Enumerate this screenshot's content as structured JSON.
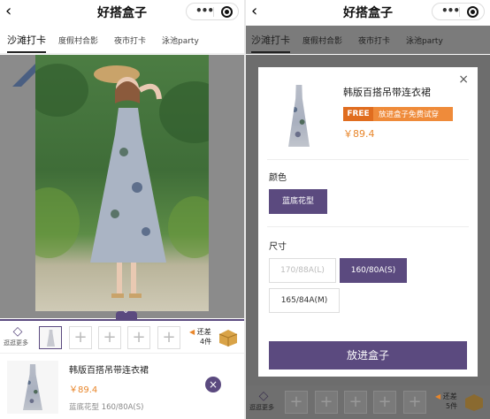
{
  "page": {
    "title": "好搭盒子",
    "back_glyph": "‹",
    "more_glyph": "•••"
  },
  "tabs": [
    "沙滩打卡",
    "度假村合影",
    "夜市打卡",
    "泳池party"
  ],
  "left": {
    "bottom_bar": {
      "more_label": "逛逛更多",
      "add_glyph": "+",
      "remaining_prefix": "还差",
      "remaining_count": "4件"
    },
    "item": {
      "name": "韩版百搭吊带连衣裙",
      "price": "￥89.4",
      "spec": "蓝底花型 160/80A(S)",
      "remove_glyph": "×"
    }
  },
  "right": {
    "bottom_bar": {
      "more_label": "逛逛更多",
      "add_glyph": "+",
      "remaining_prefix": "还差",
      "remaining_count": "5件"
    },
    "sheet": {
      "close_glyph": "×",
      "name": "韩版百搭吊带连衣裙",
      "free_tag": "FREE",
      "free_text": "放进盒子免费试穿",
      "price": "￥89.4",
      "color_label": "颜色",
      "colors": [
        {
          "label": "蓝底花型",
          "state": "selected"
        }
      ],
      "size_label": "尺寸",
      "sizes": [
        {
          "label": "170/88A(L)",
          "state": "disabled"
        },
        {
          "label": "160/80A(S)",
          "state": "selected"
        },
        {
          "label": "165/84A(M)",
          "state": "normal"
        }
      ],
      "confirm_label": "放进盒子"
    }
  },
  "colors": {
    "accent": "#5b4a7f",
    "price": "#e8862b",
    "free_badge": "#ef8b3a"
  }
}
